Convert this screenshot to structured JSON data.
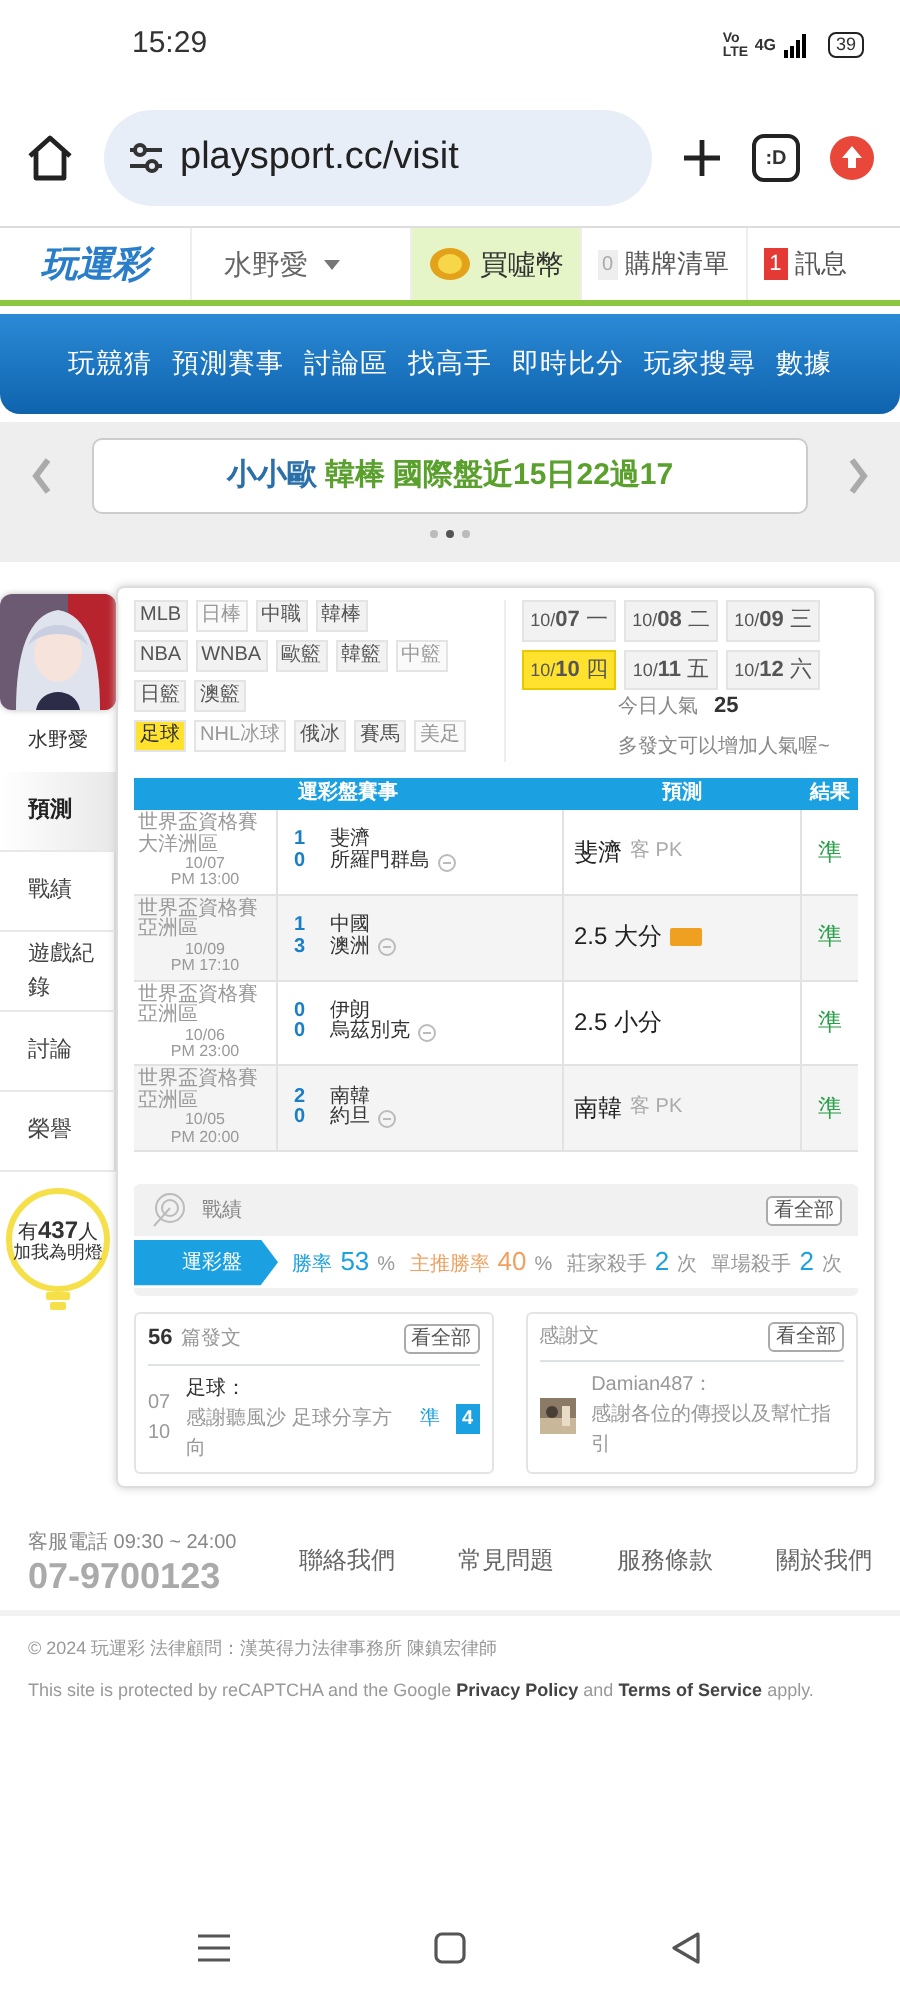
{
  "status_bar": {
    "time": "15:29",
    "volte": "Vo LTE",
    "network": "4G",
    "battery": "39"
  },
  "browser": {
    "url": "playsport.cc/visit",
    "tabs": ":D"
  },
  "header": {
    "logo": "玩運彩",
    "user": "水野愛",
    "coin": "買噓幣",
    "cart_count": "0",
    "cart": "購牌清單",
    "msg_count": "1",
    "msg": "訊息"
  },
  "nav": [
    "玩競猜",
    "預測賽事",
    "討論區",
    "找高手",
    "即時比分",
    "玩家搜尋",
    "數據"
  ],
  "banner": {
    "name": "小小歐",
    "text": "韓棒 國際盤近15日22過17",
    "dots": [
      {
        "selected": false
      },
      {
        "selected": true
      },
      {
        "selected": false
      }
    ]
  },
  "profile": {
    "name": "水野愛"
  },
  "menu": [
    {
      "label": "預測",
      "selected": true
    },
    {
      "label": "戰績",
      "selected": false
    },
    {
      "label": "遊戲紀錄",
      "selected": false
    },
    {
      "label": "討論",
      "selected": false
    },
    {
      "label": "榮譽",
      "selected": false
    }
  ],
  "lamp": {
    "prefix": "有",
    "count": "437",
    "suffix": "人",
    "caption": "加我為明燈"
  },
  "sports": [
    [
      {
        "label": "MLB",
        "selected": false,
        "disabled": false
      },
      {
        "label": "日棒",
        "selected": false,
        "disabled": true
      },
      {
        "label": "中職",
        "selected": false,
        "disabled": false
      },
      {
        "label": "韓棒",
        "selected": false,
        "disabled": false
      }
    ],
    [
      {
        "label": "NBA",
        "selected": false,
        "disabled": false
      },
      {
        "label": "WNBA",
        "selected": false,
        "disabled": false
      },
      {
        "label": "歐籃",
        "selected": false,
        "disabled": false
      },
      {
        "label": "韓籃",
        "selected": false,
        "disabled": false
      },
      {
        "label": "中籃",
        "selected": false,
        "disabled": true
      }
    ],
    [
      {
        "label": "日籃",
        "selected": false,
        "disabled": false
      },
      {
        "label": "澳籃",
        "selected": false,
        "disabled": false
      }
    ],
    [
      {
        "label": "足球",
        "selected": true,
        "disabled": false
      },
      {
        "label": "NHL冰球",
        "selected": false,
        "disabled": true
      },
      {
        "label": "俄冰",
        "selected": false,
        "disabled": false
      },
      {
        "label": "賽馬",
        "selected": false,
        "disabled": false
      },
      {
        "label": "美足",
        "selected": false,
        "disabled": true
      }
    ]
  ],
  "dates": [
    {
      "month": "10/",
      "day": "07",
      "weekday": "一",
      "selected": false
    },
    {
      "month": "10/",
      "day": "08",
      "weekday": "二",
      "selected": false
    },
    {
      "month": "10/",
      "day": "09",
      "weekday": "三",
      "selected": false
    },
    {
      "month": "10/",
      "day": "10",
      "weekday": "四",
      "selected": true
    },
    {
      "month": "10/",
      "day": "11",
      "weekday": "五",
      "selected": false
    },
    {
      "month": "10/",
      "day": "12",
      "weekday": "六",
      "selected": false
    }
  ],
  "popularity": {
    "label": "今日人氣",
    "value": "25",
    "hint": "多發文可以增加人氣喔~"
  },
  "table": {
    "columns": [
      "運彩盤賽事",
      "預測",
      "結果"
    ],
    "rows": [
      {
        "league": "世界盃資格賽大洋洲區",
        "date": "10/07",
        "time": "PM 13:00",
        "teams": [
          {
            "score": "1",
            "name": "斐濟",
            "home": false
          },
          {
            "score": "0",
            "name": "所羅門群島",
            "home": true
          }
        ],
        "pick": "斐濟",
        "pick_note": "客 PK",
        "featured": false,
        "result": "準"
      },
      {
        "league": "世界盃資格賽亞洲區",
        "date": "10/09",
        "time": "PM 17:10",
        "teams": [
          {
            "score": "1",
            "name": "中國",
            "home": false
          },
          {
            "score": "3",
            "name": "澳洲",
            "home": true
          }
        ],
        "pick": "2.5 大分",
        "pick_note": "",
        "featured": true,
        "result": "準"
      },
      {
        "league": "世界盃資格賽亞洲區",
        "date": "10/06",
        "time": "PM 23:00",
        "teams": [
          {
            "score": "0",
            "name": "伊朗",
            "home": false
          },
          {
            "score": "0",
            "name": "烏茲別克",
            "home": true
          }
        ],
        "pick": "2.5 小分",
        "pick_note": "",
        "featured": false,
        "result": "準"
      },
      {
        "league": "世界盃資格賽亞洲區",
        "date": "10/05",
        "time": "PM 20:00",
        "teams": [
          {
            "score": "2",
            "name": "南韓",
            "home": false
          },
          {
            "score": "0",
            "name": "約旦",
            "home": true
          }
        ],
        "pick": "南韓",
        "pick_note": "客 PK",
        "featured": false,
        "result": "準"
      }
    ]
  },
  "record": {
    "title": "戰績",
    "more": "看全部",
    "tabs": [
      {
        "kind": "tab",
        "label": "運彩盤",
        "selected": true
      },
      {
        "kind": "rate",
        "label": "勝率",
        "value": "53",
        "unit": "%"
      },
      {
        "kind": "main",
        "label": "主推勝率",
        "value": "40",
        "unit": "%"
      },
      {
        "kind": "count",
        "label": "莊家殺手",
        "value": "2",
        "unit": "次"
      },
      {
        "kind": "count",
        "label": "單場殺手",
        "value": "2",
        "unit": "次"
      }
    ]
  },
  "posts": {
    "count": "56",
    "title": "篇發文",
    "more": "看全部",
    "item": {
      "month": "07",
      "day": "10",
      "category": "足球：",
      "text": "感謝聽風沙 足球分享方向",
      "tag": "準",
      "badge": "4"
    }
  },
  "replies": {
    "title": "感謝文",
    "more": "看全部",
    "item": {
      "user": "Damian487：",
      "text": "感謝各位的傳授以及幫忙指引"
    }
  },
  "footer": {
    "hotline": "客服電話 09:30 ~ 24:00",
    "phone": "07-9700123",
    "links": [
      "聯絡我們",
      "常見問題",
      "服務條款",
      "關於我們"
    ],
    "copyright": "© 2024 玩運彩 法律顧問：漢英得力法律事務所 陳鎮宏律師",
    "recaptcha": {
      "before": "This site is protected by reCAPTCHA and the Google",
      "link1": "Privacy Policy",
      "middle": "and",
      "link2": "Terms of Service",
      "after": "apply."
    }
  }
}
